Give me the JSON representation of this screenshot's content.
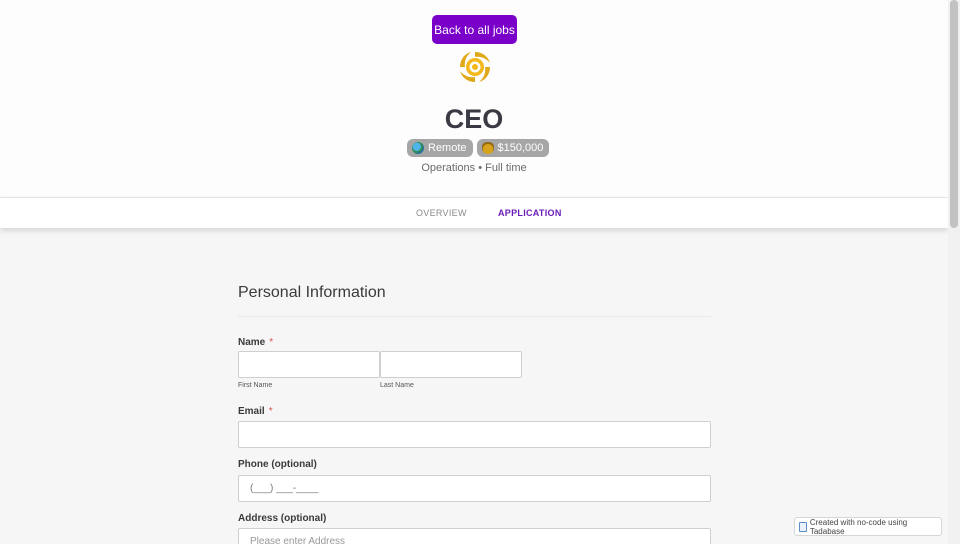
{
  "header": {
    "back_button": "Back to all jobs",
    "title": "CEO",
    "badges": [
      {
        "label": "Remote",
        "icon": "globe-icon"
      },
      {
        "label": "$150,000",
        "icon": "money-bag-icon"
      }
    ],
    "subinfo": "Operations • Full time"
  },
  "tabs": [
    {
      "label": "OVERVIEW",
      "active": false
    },
    {
      "label": "APPLICATION",
      "active": true
    }
  ],
  "form": {
    "section_title": "Personal Information",
    "name_label": "Name",
    "required_mark": "*",
    "first_name_sublabel": "First Name",
    "last_name_sublabel": "Last Name",
    "email_label": "Email",
    "phone_label": "Phone (optional)",
    "phone_mask": "(___) ___-____",
    "address_label": "Address (optional)",
    "address_placeholder": "Please enter Address"
  },
  "footer": {
    "tadabase_badge": "Created with no-code using Tadabase"
  },
  "colors": {
    "accent": "#7a00c9",
    "active_tab": "#6a1bb8",
    "badge_bg": "#a6a6a6"
  }
}
